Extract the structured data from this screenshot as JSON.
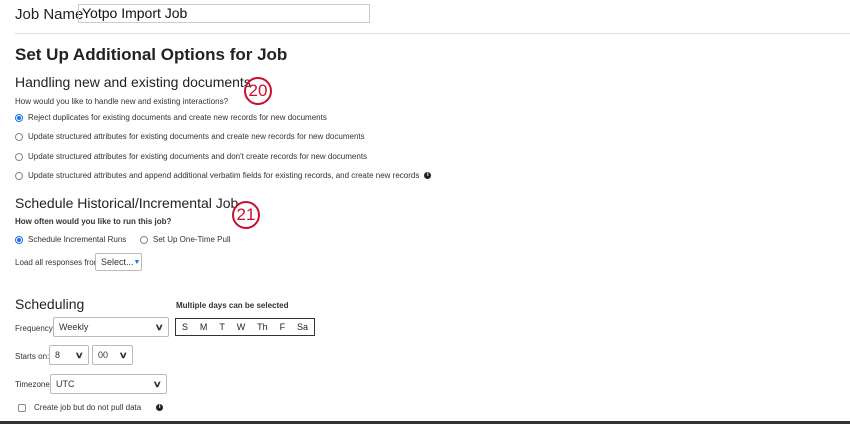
{
  "job_name": {
    "label": "Job Name",
    "value": "Yotpo Import Job"
  },
  "title": "Set Up Additional Options for Job",
  "handling": {
    "heading": "Handling new and existing documents",
    "question": "How would you like to handle new and existing interactions?",
    "options": [
      "Reject duplicates for existing documents and create new records for new documents",
      "Update structured attributes for existing documents and create new records for new documents",
      "Update structured attributes for existing documents and don't create records for new documents",
      "Update structured attributes and append additional verbatim fields for existing records, and create new records"
    ],
    "selected": 0,
    "badge": "20"
  },
  "schedule": {
    "heading": "Schedule Historical/Incremental Job",
    "question": "How often would you like to run this job?",
    "options": [
      "Schedule Incremental Runs",
      "Set Up One-Time Pull"
    ],
    "selected": 0,
    "load_label": "Load all responses from:",
    "load_value": "Select...",
    "badge": "21"
  },
  "scheduling": {
    "heading": "Scheduling",
    "days_note": "Multiple days can be selected",
    "frequency_label": "Frequency:",
    "frequency": "Weekly",
    "days": [
      "S",
      "M",
      "T",
      "W",
      "Th",
      "F",
      "Sa"
    ],
    "starts_label": "Starts on:",
    "hour": "8",
    "minute": "00",
    "timezone_label": "Timezone:",
    "timezone": "UTC",
    "checkbox_label": "Create job but do not pull data",
    "info": "i"
  }
}
